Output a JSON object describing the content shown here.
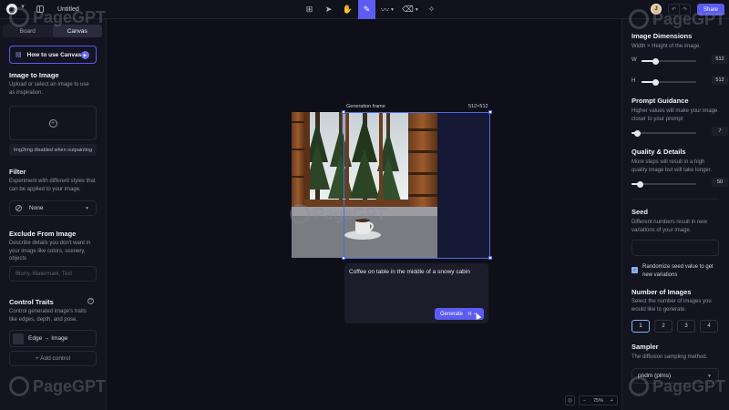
{
  "topbar": {
    "logo": "◉",
    "doc_title": "Untitled",
    "tools": [
      {
        "icon": "image-add-icon",
        "glyph": "⊞"
      },
      {
        "icon": "select-arrow-icon",
        "glyph": "➤"
      },
      {
        "icon": "hand-pan-icon",
        "glyph": "✋"
      },
      {
        "icon": "generate-frame-icon",
        "glyph": "✎",
        "active": true
      },
      {
        "icon": "brush-icon",
        "glyph": "〰"
      },
      {
        "icon": "eraser-icon",
        "glyph": "⌫"
      },
      {
        "icon": "magic-wand-icon",
        "glyph": "✧"
      }
    ],
    "avatar_initial": "J",
    "share_label": "Share"
  },
  "left": {
    "tabs": [
      "Board",
      "Canvas"
    ],
    "active_tab": "Canvas",
    "howto_label": "How to use Canvas",
    "image_to_image": {
      "title": "Image to Image",
      "desc": "Upload or select an image to use as inspiration.",
      "notice": "Img2img disabled when outpainting"
    },
    "filter": {
      "title": "Filter",
      "desc": "Experiment with different styles that can be applied to your image.",
      "value": "None"
    },
    "exclude": {
      "title": "Exclude From Image",
      "desc": "Describe details you don't want in your image like colors, scenery, objects",
      "placeholder": "Blurry, Watermark, Text"
    },
    "control": {
      "title": "Control Traits",
      "desc": "Control generated image's traits like edges, depth, and pose.",
      "trait": "Edge → Image",
      "add_label": "+ Add control"
    }
  },
  "canvas": {
    "frame_label": "Generation frame",
    "frame_size": "512×512",
    "prompt": "Coffee on table in the middle of a snowy cabin",
    "generate_label": "Generate",
    "generate_shortcut": "⌘ ↵",
    "zoom": "75%"
  },
  "right": {
    "dimensions": {
      "title": "Image Dimensions",
      "desc": "Width × Height of the image.",
      "w_label": "W",
      "h_label": "H",
      "width": "512",
      "height": "512",
      "width_fraction": 0.25,
      "height_fraction": 0.25
    },
    "guidance": {
      "title": "Prompt Guidance",
      "desc": "Higher values will make your image closer to your prompt",
      "value": "7",
      "fraction": 0.08
    },
    "quality": {
      "title": "Quality & Details",
      "desc": "More steps will result in a high quality image but will take longer.",
      "value": "50",
      "fraction": 0.12
    },
    "seed": {
      "title": "Seed",
      "desc": "Different numbers result in new variations of your image.",
      "randomize_label": "Randomize seed value to get new variations"
    },
    "num_images": {
      "title": "Number of Images",
      "desc": "Select the number of images you would like to generate.",
      "options": [
        "1",
        "2",
        "3",
        "4"
      ],
      "selected": "1"
    },
    "sampler": {
      "title": "Sampler",
      "desc": "The diffusion sampling method.",
      "value": "pndm (plms)"
    }
  },
  "watermark": "PageGPT",
  "colors": {
    "accent": "#5b5cf0",
    "frame": "#4a6ee0",
    "background": "#0e0f19",
    "panel": "#13141f"
  }
}
